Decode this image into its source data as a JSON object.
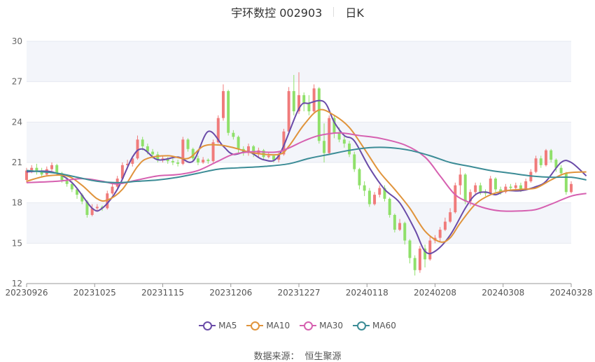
{
  "header": {
    "title": "宇环数控 002903",
    "period": "日K"
  },
  "legend": {
    "ma5": "MA5",
    "ma10": "MA10",
    "ma30": "MA30",
    "ma60": "MA60"
  },
  "footer": {
    "source_label": "数据来源：",
    "source_name": "恒生聚源"
  },
  "colors": {
    "up": "#f07b7b",
    "down": "#8fe06a",
    "ma5": "#6a4ba8",
    "ma10": "#e0943c",
    "ma30": "#d660b0",
    "ma60": "#3c8c96",
    "grid": "#e6e9f0",
    "band": "#f3f5fa"
  },
  "chart_data": {
    "type": "candlestick",
    "title": "宇环数控 002903",
    "ylim": [
      12,
      30
    ],
    "yticks": [
      12,
      15,
      18,
      21,
      24,
      27,
      30
    ],
    "xtick_labels": [
      "20230926",
      "20231025",
      "20231115",
      "20231206",
      "20231227",
      "20240118",
      "20240208",
      "20240308",
      "20240328"
    ],
    "candles": [
      {
        "o": 19.7,
        "c": 20.4,
        "h": 20.6,
        "l": 19.5
      },
      {
        "o": 20.4,
        "c": 20.6,
        "h": 20.8,
        "l": 20.2
      },
      {
        "o": 20.6,
        "c": 20.3,
        "h": 20.9,
        "l": 20.1
      },
      {
        "o": 20.3,
        "c": 20.1,
        "h": 20.6,
        "l": 19.9
      },
      {
        "o": 20.1,
        "c": 20.5,
        "h": 20.7,
        "l": 20.0
      },
      {
        "o": 20.5,
        "c": 20.8,
        "h": 21.0,
        "l": 20.2
      },
      {
        "o": 20.8,
        "c": 20.2,
        "h": 20.9,
        "l": 20.0
      },
      {
        "o": 20.2,
        "c": 19.7,
        "h": 20.3,
        "l": 19.5
      },
      {
        "o": 19.7,
        "c": 19.4,
        "h": 19.9,
        "l": 19.2
      },
      {
        "o": 19.4,
        "c": 19.0,
        "h": 19.6,
        "l": 18.8
      },
      {
        "o": 19.0,
        "c": 18.6,
        "h": 19.1,
        "l": 18.3
      },
      {
        "o": 18.6,
        "c": 18.1,
        "h": 18.7,
        "l": 17.9
      },
      {
        "o": 18.1,
        "c": 17.1,
        "h": 18.2,
        "l": 16.9
      },
      {
        "o": 17.1,
        "c": 17.6,
        "h": 17.9,
        "l": 17.0
      },
      {
        "o": 17.6,
        "c": 17.7,
        "h": 17.9,
        "l": 17.4
      },
      {
        "o": 17.7,
        "c": 17.6,
        "h": 17.8,
        "l": 17.4
      },
      {
        "o": 17.6,
        "c": 18.7,
        "h": 18.9,
        "l": 17.5
      },
      {
        "o": 18.7,
        "c": 19.2,
        "h": 19.4,
        "l": 18.6
      },
      {
        "o": 19.2,
        "c": 19.8,
        "h": 20.0,
        "l": 19.0
      },
      {
        "o": 19.8,
        "c": 20.8,
        "h": 21.0,
        "l": 19.7
      },
      {
        "o": 20.8,
        "c": 20.9,
        "h": 21.2,
        "l": 20.5
      },
      {
        "o": 20.9,
        "c": 21.3,
        "h": 21.5,
        "l": 20.7
      },
      {
        "o": 21.3,
        "c": 22.7,
        "h": 23.0,
        "l": 21.2
      },
      {
        "o": 22.7,
        "c": 22.2,
        "h": 22.9,
        "l": 21.9
      },
      {
        "o": 22.2,
        "c": 21.8,
        "h": 22.4,
        "l": 21.6
      },
      {
        "o": 21.8,
        "c": 21.6,
        "h": 22.0,
        "l": 21.3
      },
      {
        "o": 21.6,
        "c": 21.2,
        "h": 21.8,
        "l": 21.0
      },
      {
        "o": 21.2,
        "c": 21.3,
        "h": 21.5,
        "l": 21.0
      },
      {
        "o": 21.3,
        "c": 21.1,
        "h": 21.4,
        "l": 20.9
      },
      {
        "o": 21.1,
        "c": 21.0,
        "h": 21.3,
        "l": 20.8
      },
      {
        "o": 21.0,
        "c": 20.9,
        "h": 21.2,
        "l": 20.7
      },
      {
        "o": 20.9,
        "c": 22.7,
        "h": 22.9,
        "l": 20.8
      },
      {
        "o": 22.7,
        "c": 22.0,
        "h": 22.8,
        "l": 21.8
      },
      {
        "o": 22.0,
        "c": 21.3,
        "h": 22.1,
        "l": 21.1
      },
      {
        "o": 21.3,
        "c": 21.0,
        "h": 21.5,
        "l": 20.8
      },
      {
        "o": 21.0,
        "c": 21.2,
        "h": 21.4,
        "l": 20.9
      },
      {
        "o": 21.2,
        "c": 21.1,
        "h": 21.3,
        "l": 20.9
      },
      {
        "o": 21.1,
        "c": 22.5,
        "h": 22.7,
        "l": 21.0
      },
      {
        "o": 22.5,
        "c": 24.3,
        "h": 24.5,
        "l": 22.4
      },
      {
        "o": 24.3,
        "c": 26.3,
        "h": 26.8,
        "l": 24.1
      },
      {
        "o": 26.3,
        "c": 23.2,
        "h": 26.4,
        "l": 23.0
      },
      {
        "o": 23.2,
        "c": 22.9,
        "h": 23.4,
        "l": 22.7
      },
      {
        "o": 22.9,
        "c": 22.0,
        "h": 23.0,
        "l": 21.7
      },
      {
        "o": 22.0,
        "c": 21.7,
        "h": 22.2,
        "l": 21.5
      },
      {
        "o": 21.7,
        "c": 22.2,
        "h": 22.4,
        "l": 21.5
      },
      {
        "o": 22.2,
        "c": 21.6,
        "h": 22.3,
        "l": 21.4
      },
      {
        "o": 21.6,
        "c": 21.9,
        "h": 22.1,
        "l": 21.4
      },
      {
        "o": 21.9,
        "c": 21.4,
        "h": 22.0,
        "l": 21.2
      },
      {
        "o": 21.4,
        "c": 21.5,
        "h": 21.8,
        "l": 21.3
      },
      {
        "o": 21.5,
        "c": 21.2,
        "h": 21.6,
        "l": 21.0
      },
      {
        "o": 21.2,
        "c": 21.6,
        "h": 21.8,
        "l": 21.0
      },
      {
        "o": 21.6,
        "c": 23.3,
        "h": 23.5,
        "l": 21.5
      },
      {
        "o": 23.3,
        "c": 26.3,
        "h": 26.6,
        "l": 23.2
      },
      {
        "o": 26.3,
        "c": 24.8,
        "h": 27.5,
        "l": 24.5
      },
      {
        "o": 24.8,
        "c": 26.0,
        "h": 27.7,
        "l": 24.6
      },
      {
        "o": 26.0,
        "c": 25.4,
        "h": 26.2,
        "l": 24.8
      },
      {
        "o": 25.4,
        "c": 24.8,
        "h": 26.0,
        "l": 24.5
      },
      {
        "o": 24.8,
        "c": 26.5,
        "h": 26.8,
        "l": 24.7
      },
      {
        "o": 26.5,
        "c": 22.6,
        "h": 26.6,
        "l": 22.4
      },
      {
        "o": 22.6,
        "c": 21.7,
        "h": 23.9,
        "l": 21.0
      },
      {
        "o": 21.7,
        "c": 24.3,
        "h": 24.5,
        "l": 21.6
      },
      {
        "o": 24.3,
        "c": 23.2,
        "h": 24.5,
        "l": 22.8
      },
      {
        "o": 23.2,
        "c": 22.7,
        "h": 23.6,
        "l": 22.5
      },
      {
        "o": 22.7,
        "c": 22.4,
        "h": 23.0,
        "l": 22.1
      },
      {
        "o": 22.4,
        "c": 21.6,
        "h": 22.6,
        "l": 21.4
      },
      {
        "o": 21.6,
        "c": 20.5,
        "h": 21.8,
        "l": 20.3
      },
      {
        "o": 20.5,
        "c": 19.3,
        "h": 20.6,
        "l": 19.0
      },
      {
        "o": 19.3,
        "c": 18.9,
        "h": 19.6,
        "l": 18.5
      },
      {
        "o": 18.9,
        "c": 17.9,
        "h": 19.1,
        "l": 17.7
      },
      {
        "o": 17.9,
        "c": 18.6,
        "h": 18.8,
        "l": 17.8
      },
      {
        "o": 18.6,
        "c": 19.1,
        "h": 19.3,
        "l": 18.4
      },
      {
        "o": 19.1,
        "c": 18.3,
        "h": 19.3,
        "l": 18.1
      },
      {
        "o": 18.3,
        "c": 17.1,
        "h": 18.4,
        "l": 16.9
      },
      {
        "o": 17.1,
        "c": 16.0,
        "h": 17.2,
        "l": 15.8
      },
      {
        "o": 16.0,
        "c": 16.5,
        "h": 16.8,
        "l": 15.9
      },
      {
        "o": 16.5,
        "c": 15.2,
        "h": 16.6,
        "l": 14.9
      },
      {
        "o": 15.2,
        "c": 13.9,
        "h": 15.3,
        "l": 13.5
      },
      {
        "o": 13.9,
        "c": 13.0,
        "h": 14.1,
        "l": 12.6
      },
      {
        "o": 13.0,
        "c": 14.6,
        "h": 14.8,
        "l": 12.8
      },
      {
        "o": 14.6,
        "c": 13.8,
        "h": 14.9,
        "l": 13.2
      },
      {
        "o": 13.8,
        "c": 15.2,
        "h": 15.5,
        "l": 13.7
      },
      {
        "o": 15.2,
        "c": 15.4,
        "h": 15.6,
        "l": 15.0
      },
      {
        "o": 15.4,
        "c": 16.0,
        "h": 16.2,
        "l": 15.1
      },
      {
        "o": 16.0,
        "c": 16.6,
        "h": 16.9,
        "l": 15.9
      },
      {
        "o": 16.6,
        "c": 17.3,
        "h": 17.6,
        "l": 16.5
      },
      {
        "o": 17.3,
        "c": 19.3,
        "h": 19.5,
        "l": 17.2
      },
      {
        "o": 19.3,
        "c": 20.1,
        "h": 20.6,
        "l": 18.6
      },
      {
        "o": 20.1,
        "c": 18.1,
        "h": 20.2,
        "l": 17.9
      },
      {
        "o": 18.1,
        "c": 18.8,
        "h": 19.0,
        "l": 17.8
      },
      {
        "o": 18.8,
        "c": 19.3,
        "h": 19.5,
        "l": 18.6
      },
      {
        "o": 19.3,
        "c": 18.8,
        "h": 19.5,
        "l": 18.6
      },
      {
        "o": 18.8,
        "c": 18.7,
        "h": 19.0,
        "l": 18.5
      },
      {
        "o": 18.7,
        "c": 19.8,
        "h": 20.0,
        "l": 18.6
      },
      {
        "o": 19.8,
        "c": 19.0,
        "h": 19.9,
        "l": 18.8
      },
      {
        "o": 19.0,
        "c": 18.8,
        "h": 19.2,
        "l": 18.6
      },
      {
        "o": 18.8,
        "c": 19.2,
        "h": 19.4,
        "l": 18.7
      },
      {
        "o": 19.2,
        "c": 19.1,
        "h": 19.4,
        "l": 18.9
      },
      {
        "o": 19.1,
        "c": 19.3,
        "h": 19.5,
        "l": 19.0
      },
      {
        "o": 19.3,
        "c": 19.0,
        "h": 19.5,
        "l": 18.8
      },
      {
        "o": 19.0,
        "c": 19.6,
        "h": 19.8,
        "l": 18.9
      },
      {
        "o": 19.6,
        "c": 20.3,
        "h": 20.5,
        "l": 19.5
      },
      {
        "o": 20.3,
        "c": 21.3,
        "h": 21.5,
        "l": 20.2
      },
      {
        "o": 21.3,
        "c": 20.8,
        "h": 21.5,
        "l": 20.6
      },
      {
        "o": 20.8,
        "c": 21.9,
        "h": 22.0,
        "l": 20.7
      },
      {
        "o": 21.9,
        "c": 21.2,
        "h": 22.0,
        "l": 21.0
      },
      {
        "o": 21.2,
        "c": 20.6,
        "h": 21.3,
        "l": 20.3
      },
      {
        "o": 20.6,
        "c": 20.2,
        "h": 20.8,
        "l": 20.0
      },
      {
        "o": 20.2,
        "c": 18.8,
        "h": 20.3,
        "l": 18.6
      },
      {
        "o": 18.8,
        "c": 19.4,
        "h": 19.6,
        "l": 18.7
      }
    ],
    "series": [
      {
        "name": "MA5",
        "key": "ma5",
        "anchors": [
          [
            0,
            20.3
          ],
          [
            5,
            20.3
          ],
          [
            9,
            19.5
          ],
          [
            13,
            17.6
          ],
          [
            15,
            17.6
          ],
          [
            18,
            19.0
          ],
          [
            21,
            21.4
          ],
          [
            23,
            22.0
          ],
          [
            26,
            21.2
          ],
          [
            30,
            21.4
          ],
          [
            33,
            21.1
          ],
          [
            36,
            23.3
          ],
          [
            39,
            22.2
          ],
          [
            41,
            21.6
          ],
          [
            44,
            21.8
          ],
          [
            47,
            21.2
          ],
          [
            50,
            21.5
          ],
          [
            54,
            25.0
          ],
          [
            56,
            25.4
          ],
          [
            59,
            25.5
          ],
          [
            61,
            24.0
          ],
          [
            63,
            23.0
          ],
          [
            65,
            22.6
          ],
          [
            68,
            20.6
          ],
          [
            71,
            19.0
          ],
          [
            74,
            18.0
          ],
          [
            77,
            16.0
          ],
          [
            79,
            14.4
          ],
          [
            81,
            14.4
          ],
          [
            84,
            15.6
          ],
          [
            87,
            17.6
          ],
          [
            89,
            18.6
          ],
          [
            91,
            18.8
          ],
          [
            93,
            18.6
          ],
          [
            95,
            18.9
          ],
          [
            98,
            18.9
          ],
          [
            101,
            19.2
          ],
          [
            103,
            19.6
          ],
          [
            106,
            21.0
          ],
          [
            108,
            21.0
          ],
          [
            111,
            20.0
          ]
        ]
      },
      {
        "name": "MA10",
        "key": "ma10",
        "anchors": [
          [
            0,
            19.6
          ],
          [
            4,
            20.0
          ],
          [
            8,
            20.0
          ],
          [
            11,
            19.3
          ],
          [
            14,
            18.3
          ],
          [
            16,
            18.2
          ],
          [
            19,
            19.0
          ],
          [
            22,
            20.7
          ],
          [
            24,
            21.3
          ],
          [
            28,
            21.5
          ],
          [
            32,
            21.3
          ],
          [
            35,
            22.2
          ],
          [
            38,
            22.3
          ],
          [
            41,
            22.1
          ],
          [
            45,
            21.7
          ],
          [
            50,
            21.6
          ],
          [
            52,
            22.2
          ],
          [
            55,
            23.8
          ],
          [
            58,
            24.9
          ],
          [
            61,
            24.5
          ],
          [
            64,
            23.6
          ],
          [
            67,
            22.0
          ],
          [
            70,
            20.3
          ],
          [
            73,
            19.0
          ],
          [
            76,
            17.6
          ],
          [
            79,
            15.9
          ],
          [
            82,
            15.1
          ],
          [
            84,
            15.4
          ],
          [
            86,
            16.5
          ],
          [
            89,
            17.9
          ],
          [
            92,
            18.6
          ],
          [
            95,
            18.9
          ],
          [
            98,
            19.0
          ],
          [
            101,
            19.1
          ],
          [
            104,
            19.7
          ],
          [
            107,
            20.2
          ],
          [
            111,
            20.3
          ]
        ]
      },
      {
        "name": "MA30",
        "key": "ma30",
        "anchors": [
          [
            0,
            19.5
          ],
          [
            6,
            19.6
          ],
          [
            11,
            19.8
          ],
          [
            15,
            19.6
          ],
          [
            18,
            19.4
          ],
          [
            22,
            19.7
          ],
          [
            26,
            20.0
          ],
          [
            30,
            20.1
          ],
          [
            34,
            20.4
          ],
          [
            38,
            21.1
          ],
          [
            41,
            21.6
          ],
          [
            45,
            21.8
          ],
          [
            50,
            21.8
          ],
          [
            55,
            22.6
          ],
          [
            58,
            23.0
          ],
          [
            62,
            23.2
          ],
          [
            66,
            23.0
          ],
          [
            70,
            22.8
          ],
          [
            75,
            22.3
          ],
          [
            79,
            21.4
          ],
          [
            82,
            20.0
          ],
          [
            85,
            18.6
          ],
          [
            88,
            18.0
          ],
          [
            91,
            17.6
          ],
          [
            94,
            17.4
          ],
          [
            98,
            17.4
          ],
          [
            101,
            17.5
          ],
          [
            104,
            17.9
          ],
          [
            108,
            18.5
          ],
          [
            111,
            18.7
          ]
        ]
      },
      {
        "name": "MA60",
        "key": "ma60",
        "anchors": [
          [
            0,
            20.4
          ],
          [
            6,
            20.2
          ],
          [
            10,
            19.9
          ],
          [
            14,
            19.6
          ],
          [
            18,
            19.5
          ],
          [
            22,
            19.6
          ],
          [
            26,
            19.7
          ],
          [
            30,
            19.9
          ],
          [
            34,
            20.2
          ],
          [
            38,
            20.5
          ],
          [
            42,
            20.6
          ],
          [
            47,
            20.7
          ],
          [
            52,
            20.9
          ],
          [
            56,
            21.3
          ],
          [
            60,
            21.6
          ],
          [
            64,
            21.9
          ],
          [
            68,
            22.1
          ],
          [
            72,
            22.1
          ],
          [
            76,
            21.9
          ],
          [
            80,
            21.5
          ],
          [
            84,
            21.0
          ],
          [
            88,
            20.7
          ],
          [
            92,
            20.4
          ],
          [
            96,
            20.2
          ],
          [
            100,
            20.0
          ],
          [
            104,
            19.9
          ],
          [
            108,
            19.9
          ],
          [
            111,
            19.7
          ]
        ]
      }
    ]
  }
}
